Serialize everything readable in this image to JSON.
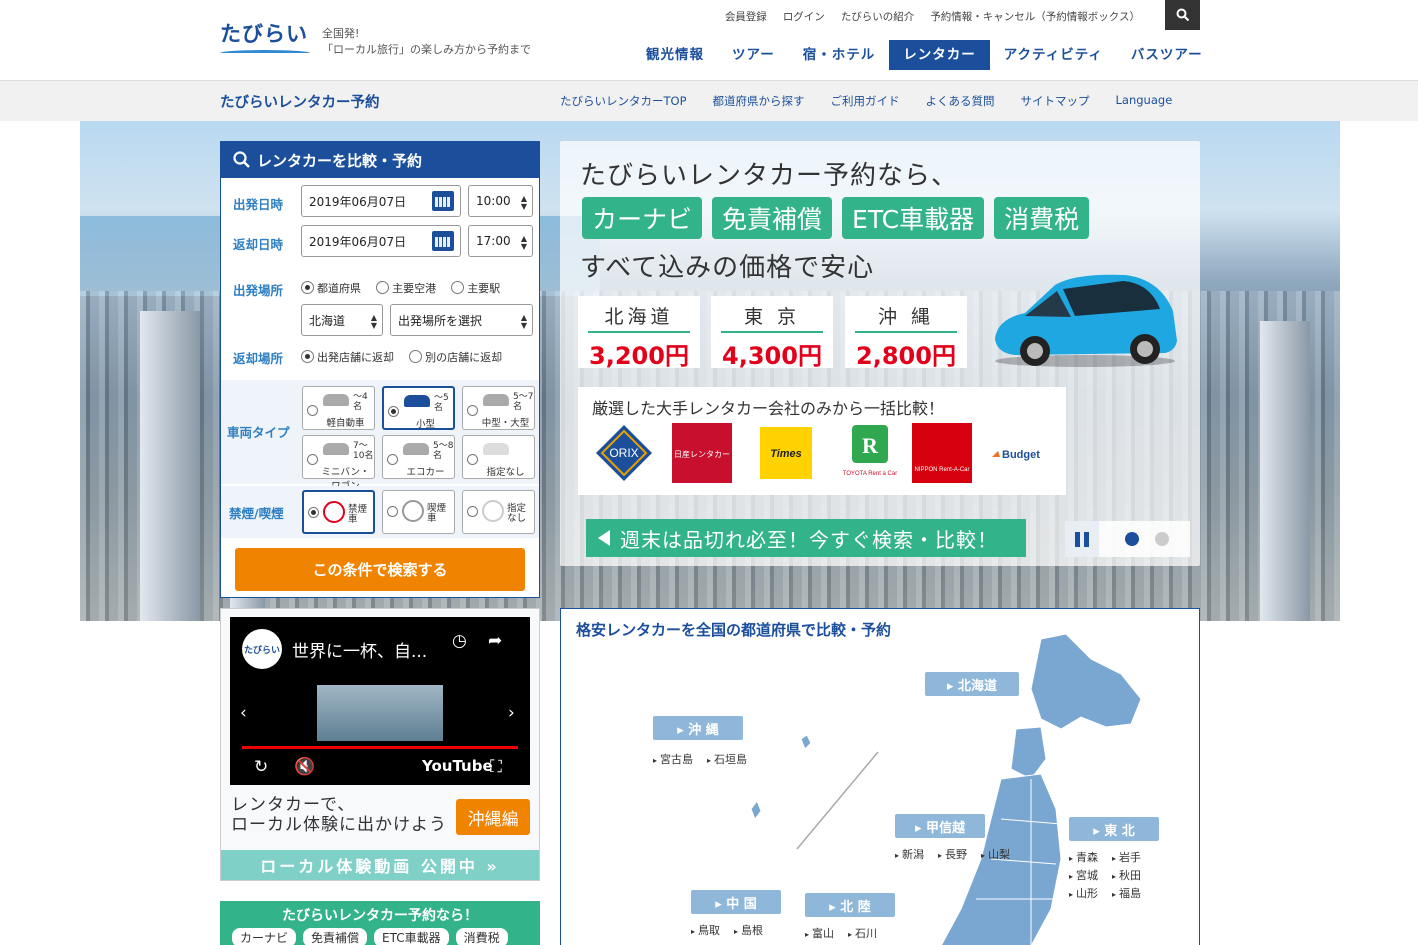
{
  "header": {
    "logo_text": "たびらい",
    "tagline_1": "全国発!",
    "tagline_2": "「ローカル旅行」の楽しみ方から予約まで",
    "util_links": [
      "会員登録",
      "ログイン",
      "たびらいの紹介",
      "予約情報・キャンセル（予約情報ボックス）"
    ],
    "main_nav": [
      "観光情報",
      "ツアー",
      "宿・ホテル",
      "レンタカー",
      "アクティビティ",
      "バスツアー"
    ],
    "active_nav": "レンタカー"
  },
  "subbar": {
    "title": "たびらいレンタカー予約",
    "links": [
      "たびらいレンタカーTOP",
      "都道府県から探す",
      "ご利用ガイド",
      "よくある質問",
      "サイトマップ",
      "Language"
    ]
  },
  "search": {
    "heading": "レンタカーを比較・予約",
    "depart_label": "出発日時",
    "depart_date": "2019年06月07日",
    "depart_time": "10:00",
    "return_label": "返却日時",
    "return_date": "2019年06月07日",
    "return_time": "17:00",
    "place_label": "出発場所",
    "place_opts": [
      "都道府県",
      "主要空港",
      "主要駅"
    ],
    "pref_value": "北海道",
    "place_value": "出発場所を選択",
    "return_place_label": "返却場所",
    "return_opts": [
      "出発店舗に返却",
      "別の店舗に返却"
    ],
    "type_label": "車両タイプ",
    "car_types": [
      {
        "cap": "〜4名",
        "name": "軽自動車"
      },
      {
        "cap": "〜5名",
        "name": "小型"
      },
      {
        "cap": "5〜7名",
        "name": "中型・大型"
      },
      {
        "cap": "7〜10名",
        "name": "ミニバン・ワゴン"
      },
      {
        "cap": "5〜8名",
        "name": "エコカー"
      },
      {
        "cap": "",
        "name": "指定なし"
      }
    ],
    "smoke_label": "禁煙/喫煙",
    "smoke_opts": [
      "禁煙車",
      "喫煙車",
      "指定なし"
    ],
    "submit": "この条件で検索する"
  },
  "promo": {
    "line1": "たびらいレンタカー予約なら、",
    "tags": [
      "カーナビ",
      "免責補償",
      "ETC車載器",
      "消費税"
    ],
    "line3": "すべて込みの価格で安心",
    "prices": [
      {
        "pref": "北海道",
        "price": "3,200円"
      },
      {
        "pref": "東 京",
        "price": "4,300円"
      },
      {
        "pref": "沖 縄",
        "price": "2,800円"
      }
    ],
    "brands_heading": "厳選した大手レンタカー会社のみから一括比較！",
    "brands": [
      "ORIX",
      "日産レンタカー",
      "Times",
      "TOYOTA Rent a Car",
      "NIPPON Rent-A-Car",
      "Budget"
    ],
    "cta": "週末は品切れ必至！今すぐ検索・比較！"
  },
  "video": {
    "channel": "たびらい",
    "title": "世界に一杯、自...",
    "yt": "YouTube",
    "caption_1": "レンタカーで、",
    "caption_2": "ローカル体験に出かけよう",
    "badge": "沖縄編",
    "footer": "ローカル体験動画 公開中 »"
  },
  "promo_small": {
    "heading": "たびらいレンタカー予約なら！",
    "chips": [
      "カーナビ",
      "免責補償",
      "ETC車載器",
      "消費税"
    ]
  },
  "map": {
    "title": "格安レンタカーを全国の都道府県で比較・予約",
    "regions": [
      {
        "name": "▸ 北海道",
        "prefs": []
      },
      {
        "name": "▸ 沖 縄",
        "prefs": [
          "宮古島",
          "石垣島"
        ]
      },
      {
        "name": "▸ 甲信越",
        "prefs": [
          "新潟",
          "長野",
          "山梨"
        ]
      },
      {
        "name": "▸ 東 北",
        "prefs": [
          "青森",
          "岩手",
          "宮城",
          "秋田",
          "山形",
          "福島"
        ]
      },
      {
        "name": "▸ 中 国",
        "prefs": [
          "鳥取",
          "島根"
        ]
      },
      {
        "name": "▸ 北 陸",
        "prefs": [
          "富山",
          "石川"
        ]
      }
    ]
  },
  "colors": {
    "brand": "#1c4f9b",
    "green": "#33b38a",
    "orange": "#f08300",
    "price_red": "#e2001a"
  }
}
